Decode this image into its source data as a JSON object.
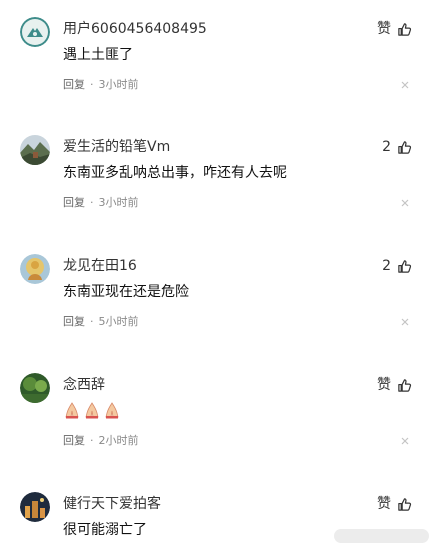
{
  "comments": [
    {
      "username": "用户6060456408495",
      "content": "遇上土匪了",
      "like_label": "赞",
      "reply_label": "回复",
      "separator": "·",
      "time": "3小时前",
      "avatar_icon": "default-user-avatar-icon",
      "avatar_color": "#3e8c8a"
    },
    {
      "username": "爱生活的铅笔Vm",
      "content": "东南亚多乱呐总出事，咋还有人去呢",
      "like_label": "2",
      "reply_label": "回复",
      "separator": "·",
      "time": "3小时前",
      "avatar_icon": "landscape-photo-avatar-icon"
    },
    {
      "username": "龙见在田16",
      "content": "东南亚现在还是危险",
      "like_label": "2",
      "reply_label": "回复",
      "separator": "·",
      "time": "5小时前",
      "avatar_icon": "buddha-art-avatar-icon"
    },
    {
      "username": "念西辞",
      "content": "",
      "emoji_icons": [
        "praying-hands-emoji",
        "praying-hands-emoji",
        "praying-hands-emoji"
      ],
      "like_label": "赞",
      "reply_label": "回复",
      "separator": "·",
      "time": "2小时前",
      "avatar_icon": "green-nature-avatar-icon"
    },
    {
      "username": "健行天下爱拍客",
      "content": "很可能溺亡了",
      "like_label": "赞",
      "avatar_icon": "city-night-avatar-icon"
    }
  ],
  "colors": {
    "meta_text": "#8a8a8a",
    "username_text": "#333333",
    "content_text": "#111111"
  }
}
